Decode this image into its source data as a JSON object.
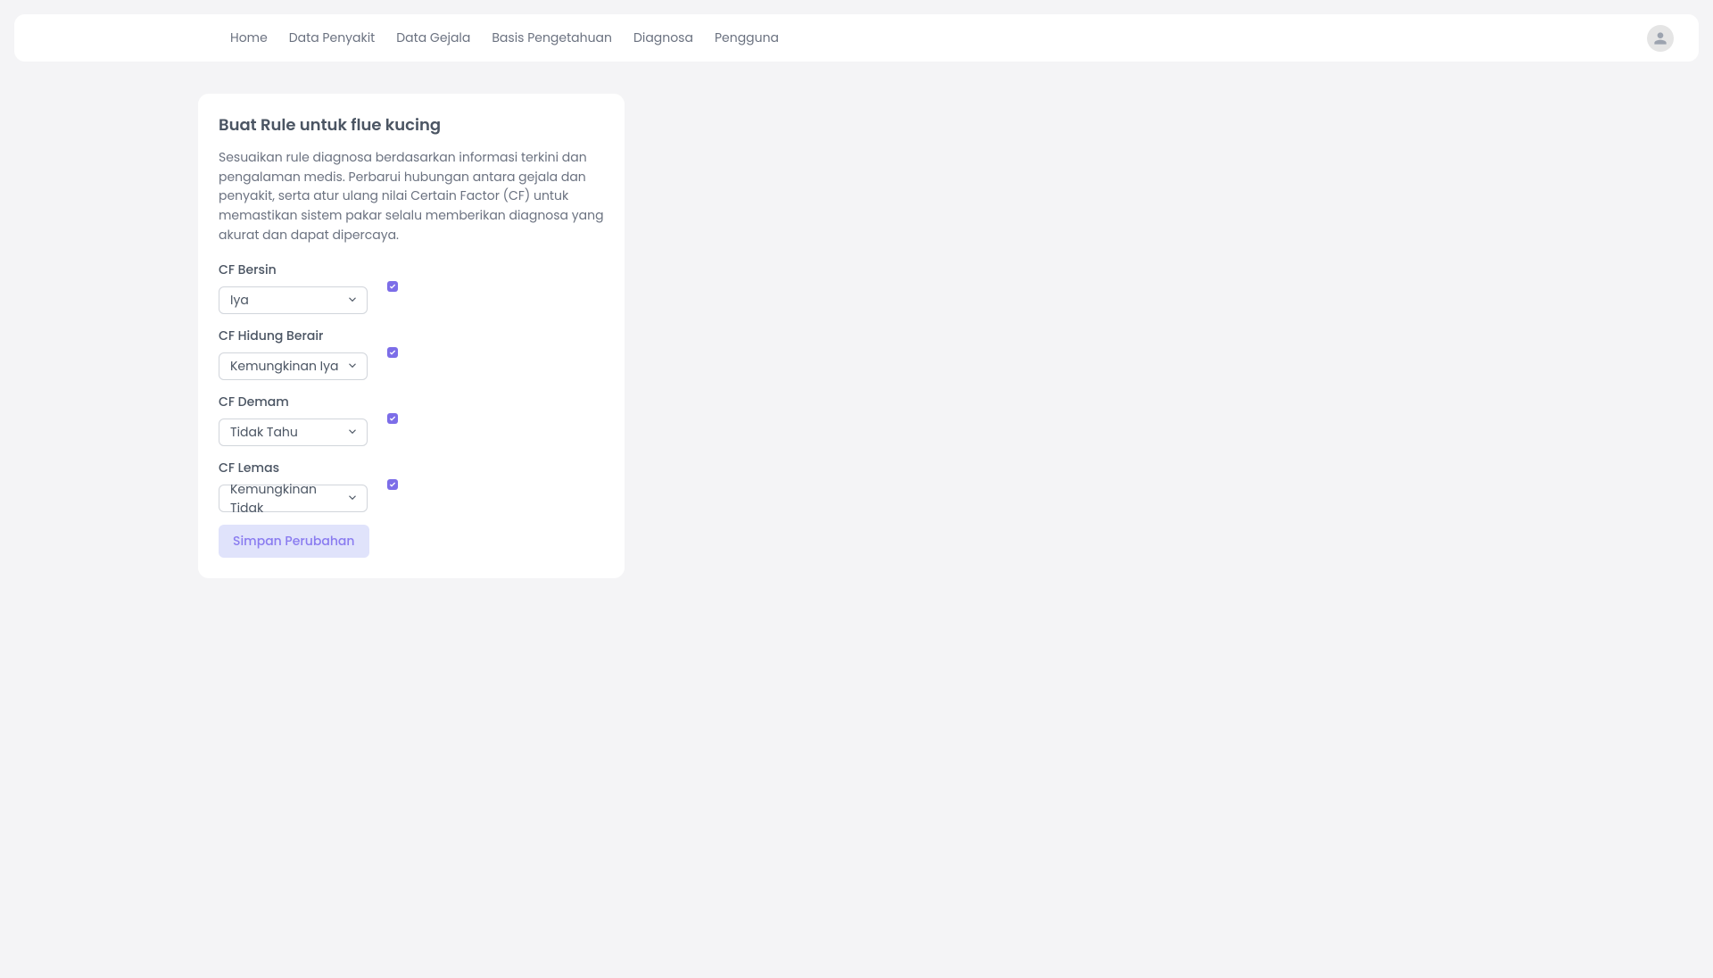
{
  "nav": {
    "items": [
      {
        "label": "Home"
      },
      {
        "label": "Data Penyakit"
      },
      {
        "label": "Data Gejala"
      },
      {
        "label": "Basis Pengetahuan"
      },
      {
        "label": "Diagnosa"
      },
      {
        "label": "Pengguna"
      }
    ]
  },
  "card": {
    "title": "Buat Rule untuk flue kucing",
    "description": "Sesuaikan rule diagnosa berdasarkan informasi terkini dan pengalaman medis. Perbarui hubungan antara gejala dan penyakit, serta atur ulang nilai Certain Factor (CF) untuk memastikan sistem pakar selalu memberikan diagnosa yang akurat dan dapat dipercaya."
  },
  "fields": [
    {
      "label": "CF Bersin",
      "value": "Iya",
      "checked": true
    },
    {
      "label": "CF Hidung Berair",
      "value": "Kemungkinan Iya",
      "checked": true
    },
    {
      "label": "CF Demam",
      "value": "Tidak Tahu",
      "checked": true
    },
    {
      "label": "CF Lemas",
      "value": "Kemungkinan Tidak",
      "checked": true
    }
  ],
  "submit": {
    "label": "Simpan Perubahan"
  }
}
